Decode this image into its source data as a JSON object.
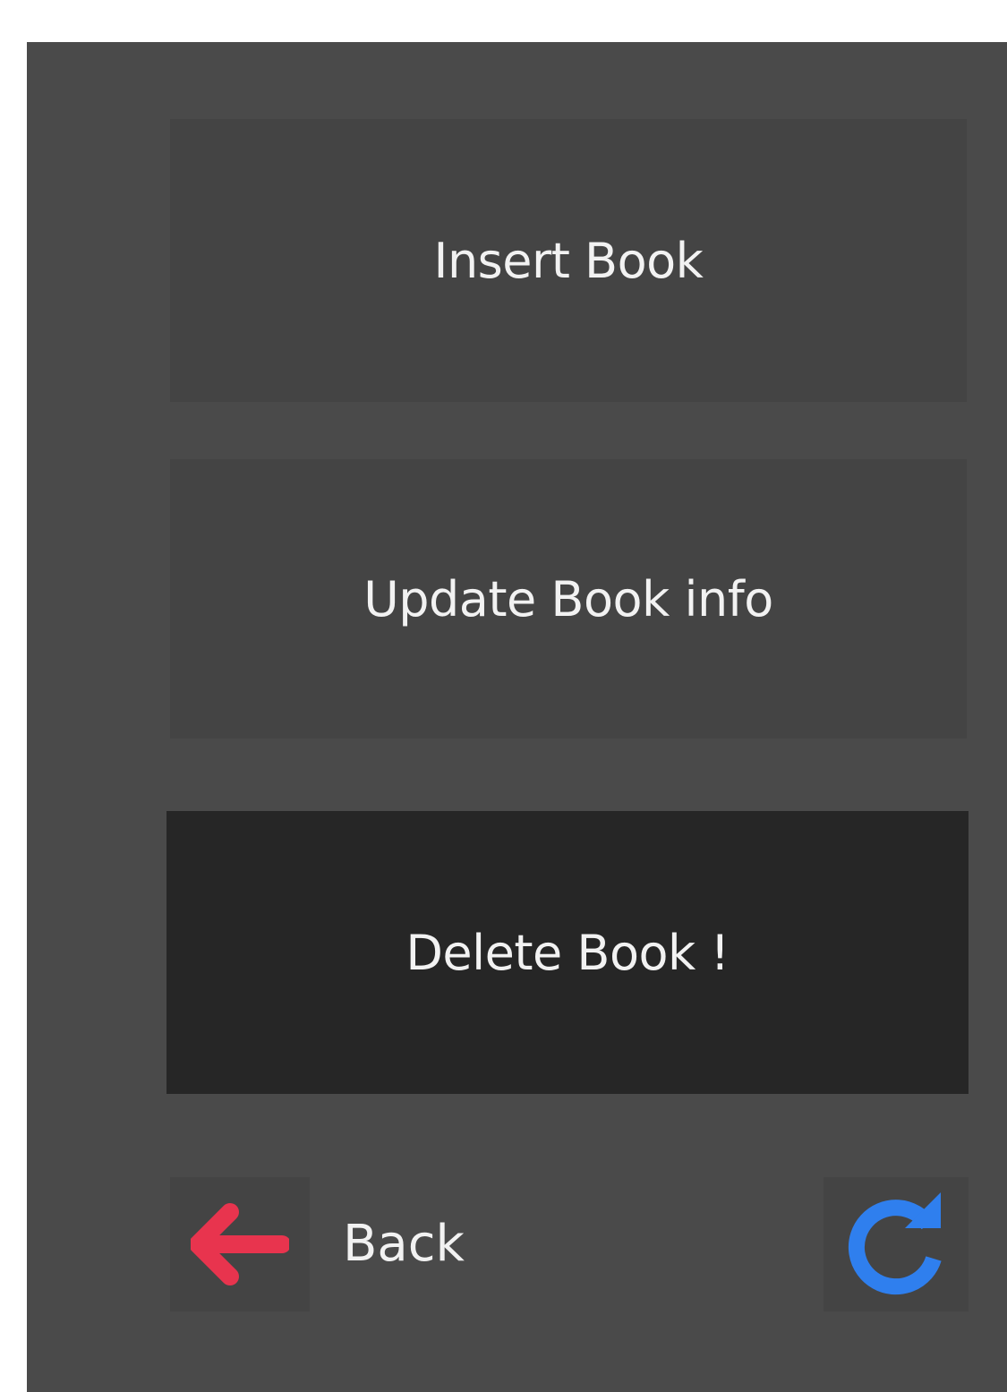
{
  "menu": {
    "insert_label": "Insert Book",
    "update_label": "Update Book info",
    "delete_label": "Delete Book !"
  },
  "footer": {
    "back_label": "Back",
    "back_icon": "arrow-left-icon",
    "refresh_icon": "refresh-icon"
  },
  "colors": {
    "background": "#4a4a4a",
    "button": "#444444",
    "button_active": "#262626",
    "text": "#f2f2f2",
    "back_arrow": "#e8344e",
    "refresh": "#2f7fee"
  }
}
